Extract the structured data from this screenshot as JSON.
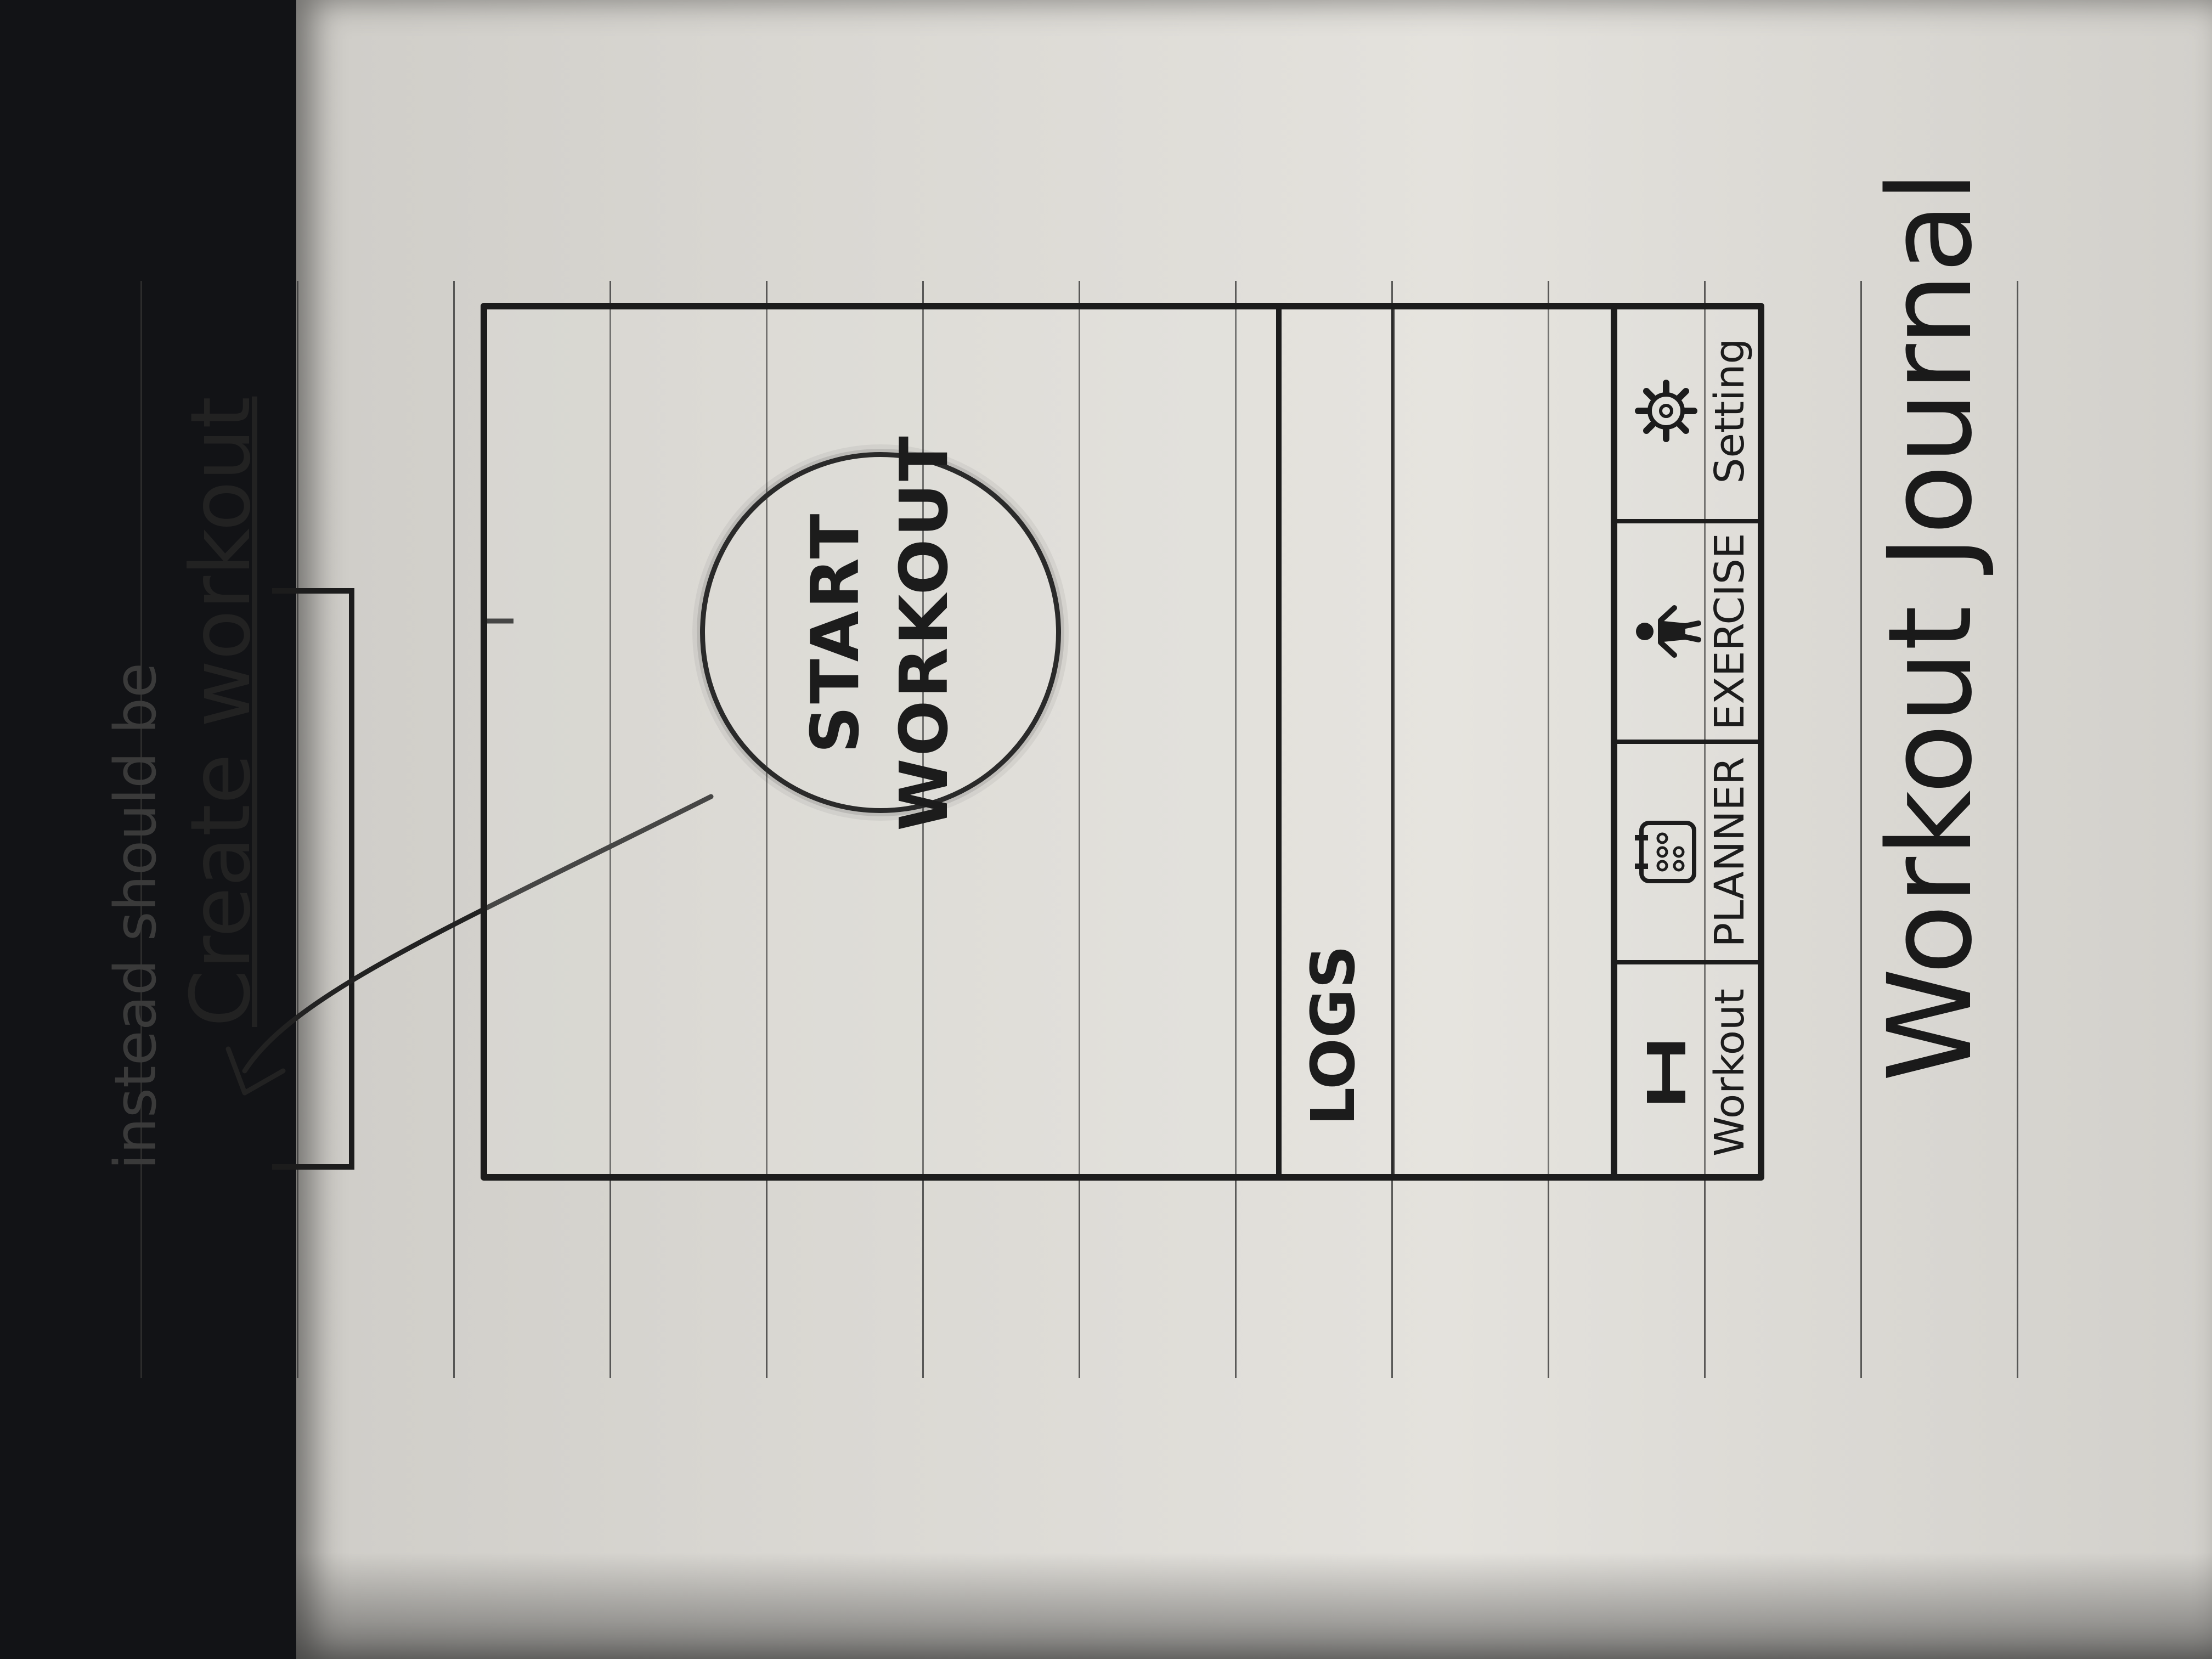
{
  "annotation": {
    "line1": "instead should be",
    "line2": "Create workout"
  },
  "main": {
    "start_line1": "START",
    "start_line2": "WORKOUT",
    "logs_label": "LOGS"
  },
  "bottom_nav": {
    "items": [
      {
        "label": "Workout",
        "icon": "dumbbell-icon"
      },
      {
        "label": "PLANNER",
        "icon": "calendar-icon"
      },
      {
        "label": "EXERCISE",
        "icon": "person-icon"
      },
      {
        "label": "Setting",
        "icon": "gear-icon"
      }
    ]
  },
  "caption": "Workout Journal",
  "colors": {
    "ink": "#1c1c1c",
    "paper": "#e0ded9",
    "desk": "#121316"
  }
}
